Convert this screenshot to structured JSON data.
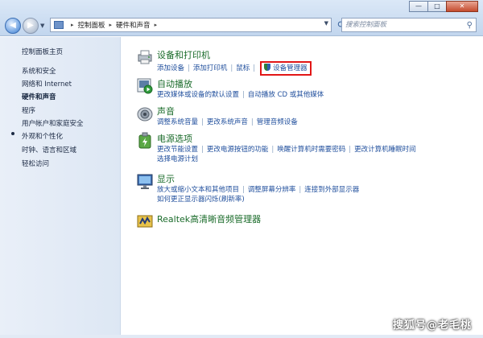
{
  "window": {
    "min": "—",
    "max": "□",
    "close": "✕"
  },
  "address": {
    "part1": "控制面板",
    "part2": "硬件和声音",
    "separator": "▸"
  },
  "search": {
    "placeholder": "搜索控制面板"
  },
  "sidebar": {
    "items": [
      {
        "label": "控制面板主页"
      },
      {
        "label": "系统和安全"
      },
      {
        "label": "网络和 Internet"
      },
      {
        "label": "硬件和声音"
      },
      {
        "label": "程序"
      },
      {
        "label": "用户帐户和家庭安全"
      },
      {
        "label": "外观和个性化"
      },
      {
        "label": "时钟、语言和区域"
      },
      {
        "label": "轻松访问"
      }
    ]
  },
  "categories": {
    "devices": {
      "title": "设备和打印机",
      "links": [
        "添加设备",
        "添加打印机",
        "鼠标",
        "设备管理器"
      ]
    },
    "autoplay": {
      "title": "自动播放",
      "links": [
        "更改媒体或设备的默认设置",
        "自动播放 CD 或其他媒体"
      ]
    },
    "sound": {
      "title": "声音",
      "links": [
        "调整系统音量",
        "更改系统声音",
        "管理音频设备"
      ]
    },
    "power": {
      "title": "电源选项",
      "links": [
        "更改节能设置",
        "更改电源按钮的功能",
        "唤醒计算机时需要密码",
        "更改计算机睡眠时间",
        "选择电源计划"
      ]
    },
    "display": {
      "title": "显示",
      "links": [
        "放大或缩小文本和其他项目",
        "调整屏幕分辨率",
        "连接到外部显示器",
        "如何更正显示器闪烁(刷新率)"
      ]
    },
    "realtek": {
      "title": "Realtek高清晰音频管理器"
    }
  },
  "watermark": "搜狐号@老毛桃",
  "colors": {
    "link": "#1f4e9c",
    "category": "#1a6b2a",
    "highlight": "#e21616"
  }
}
